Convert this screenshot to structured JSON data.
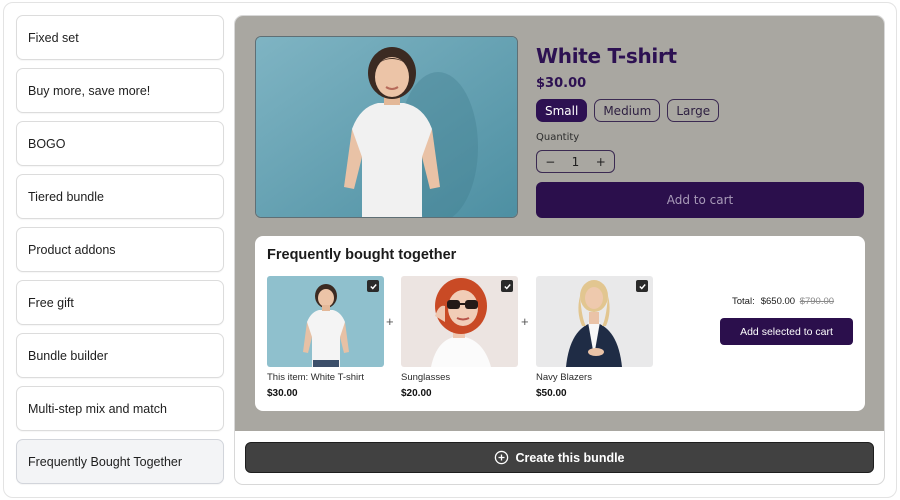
{
  "sidebar": {
    "items": [
      {
        "label": "Fixed set"
      },
      {
        "label": "Buy more, save more!"
      },
      {
        "label": "BOGO"
      },
      {
        "label": "Tiered bundle"
      },
      {
        "label": "Product addons"
      },
      {
        "label": "Free gift"
      },
      {
        "label": "Bundle builder"
      },
      {
        "label": "Multi-step mix and match"
      },
      {
        "label": "Frequently Bought Together"
      }
    ],
    "active_index": 8
  },
  "product": {
    "title": "White T-shirt",
    "price": "$30.00",
    "sizes": [
      "Small",
      "Medium",
      "Large"
    ],
    "selected_size": "Small",
    "quantity_label": "Quantity",
    "quantity": "1",
    "minus": "−",
    "plus": "+",
    "add_to_cart": "Add to cart"
  },
  "fbt": {
    "title": "Frequently bought together",
    "items": [
      {
        "name": "This item: White T-shirt",
        "price": "$30.00",
        "checked": true
      },
      {
        "name": "Sunglasses",
        "price": "$20.00",
        "checked": true
      },
      {
        "name": "Navy Blazers",
        "price": "$50.00",
        "checked": true
      }
    ],
    "plus_sign": "+",
    "total_label": "Total:",
    "total": "$650.00",
    "total_original": "$790.00",
    "add_selected": "Add selected to cart"
  },
  "footer": {
    "create_bundle": "Create this bundle"
  },
  "colors": {
    "accent": "#2b0f4c",
    "preview_bg": "#a9a7a1",
    "create_btn": "#414141"
  }
}
